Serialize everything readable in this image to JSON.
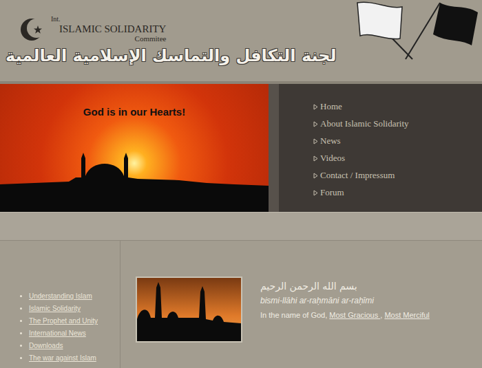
{
  "logo": {
    "prefix": "Int.",
    "name": "ISLAMIC SOLIDARITY",
    "suffix": "Commitee",
    "arabic": "لجنة التكافل والتماسك الإسلامية العالمية"
  },
  "banner": {
    "caption": "God is in our Hearts!"
  },
  "nav": [
    "Home",
    "About Islamic Solidarity",
    "News",
    "Videos",
    "Contact / Impressum",
    "Forum"
  ],
  "sidebar": [
    "Understanding Islam",
    "Islamic Solidarity",
    "The Prophet and Unity",
    "International News",
    "Downloads",
    "The war against Islam"
  ],
  "intro": {
    "arabic": "بسم الله الرحمن الرحيم",
    "transliteration": "bismi-llāhi ar-raḥmāni ar-raḥīmi",
    "segments": [
      {
        "text": "In the name of God, ",
        "link": false
      },
      {
        "text": "Most Gracious ",
        "link": true
      },
      {
        "text": ", ",
        "link": false
      },
      {
        "text": "Most Merciful",
        "link": true
      }
    ]
  }
}
